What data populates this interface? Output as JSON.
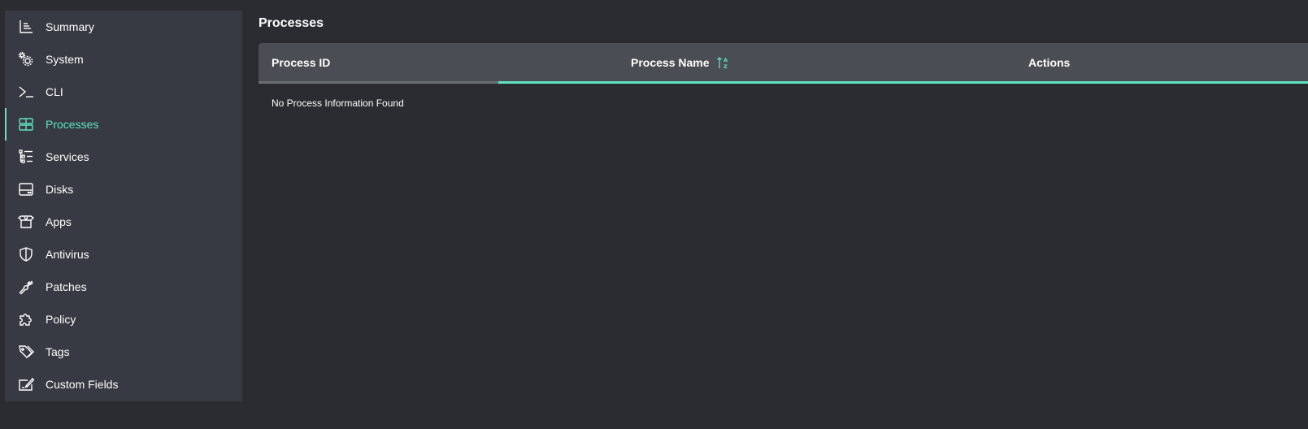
{
  "sidebar": {
    "items": [
      {
        "label": "Summary",
        "icon": "chart-axis-icon",
        "active": false
      },
      {
        "label": "System",
        "icon": "gears-icon",
        "active": false
      },
      {
        "label": "CLI",
        "icon": "terminal-icon",
        "active": false
      },
      {
        "label": "Processes",
        "icon": "layers-icon",
        "active": true
      },
      {
        "label": "Services",
        "icon": "list-tree-icon",
        "active": false
      },
      {
        "label": "Disks",
        "icon": "hard-drive-icon",
        "active": false
      },
      {
        "label": "Apps",
        "icon": "box-open-icon",
        "active": false
      },
      {
        "label": "Antivirus",
        "icon": "shield-icon",
        "active": false
      },
      {
        "label": "Patches",
        "icon": "wrench-icon",
        "active": false
      },
      {
        "label": "Policy",
        "icon": "puzzle-icon",
        "active": false
      },
      {
        "label": "Tags",
        "icon": "tags-icon",
        "active": false
      },
      {
        "label": "Custom Fields",
        "icon": "edit-field-icon",
        "active": false
      }
    ]
  },
  "main": {
    "title": "Processes",
    "table": {
      "columns": [
        {
          "label": "Process ID"
        },
        {
          "label": "Process Name",
          "sort_icon": "sort-alpha-asc-icon"
        },
        {
          "label": "Actions"
        }
      ],
      "loading_progress": 0.77,
      "empty_message": "No Process Information Found"
    }
  },
  "colors": {
    "accent": "#5fe3c0",
    "background": "#2b2c31",
    "sidebar_bg": "#373a42",
    "header_bg": "#4a4d53"
  }
}
